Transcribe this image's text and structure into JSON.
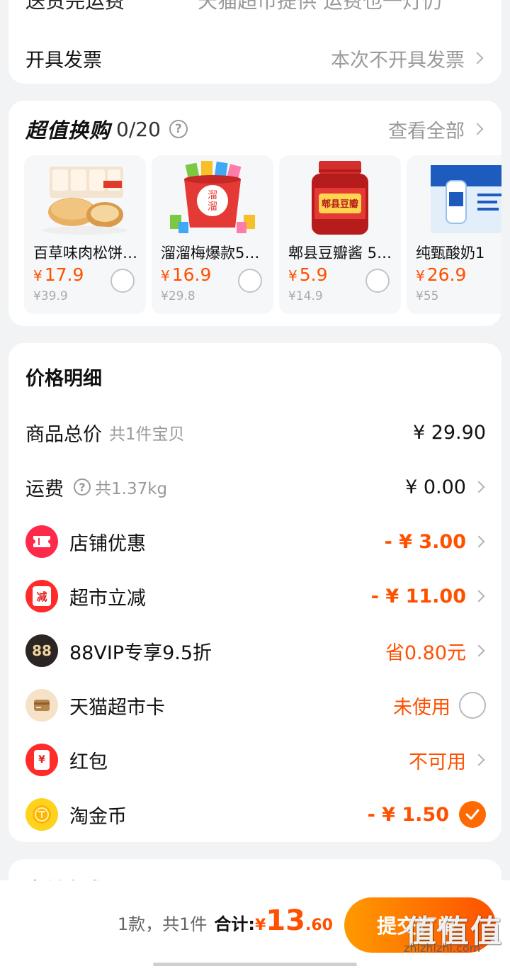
{
  "delivery": {
    "label": "送货完运费",
    "value": "天猫超市提供 运费也一灯仍"
  },
  "invoice": {
    "label": "开具发票",
    "value": "本次不开具发票"
  },
  "swap": {
    "title": "超值换购",
    "count": "0/20",
    "view_all": "查看全部",
    "products": [
      {
        "name": "百草味肉松饼…",
        "currency": "¥",
        "price": "17.9",
        "orig": "¥39.9"
      },
      {
        "name": "溜溜梅爆款5…",
        "currency": "¥",
        "price": "16.9",
        "orig": "¥29.8"
      },
      {
        "name": "郫县豆瓣酱 5…",
        "currency": "¥",
        "price": "5.9",
        "orig": "¥14.9"
      },
      {
        "name": "纯甄酸奶1",
        "currency": "¥",
        "price": "26.9",
        "orig": "¥55"
      }
    ]
  },
  "price_detail": {
    "title": "价格明细",
    "goods_total": {
      "label": "商品总价",
      "sub": "共1件宝贝",
      "value": "¥ 29.90"
    },
    "shipping": {
      "label": "运费",
      "sub": "共1.37kg",
      "value": "¥ 0.00"
    },
    "shop_discount": {
      "label": "店铺优惠",
      "value": "- ¥ 3.00"
    },
    "market_discount": {
      "label": "超市立减",
      "value": "- ¥ 11.00",
      "icon_text": "减"
    },
    "vip": {
      "label": "88VIP专享9.5折",
      "value": "省0.80元",
      "icon_text": "88"
    },
    "market_card": {
      "label": "天猫超市卡",
      "value": "未使用"
    },
    "red_packet": {
      "label": "红包",
      "value": "不可用",
      "icon_text": "¥"
    },
    "coins": {
      "label": "淘金币",
      "value": "- ¥ 1.50"
    }
  },
  "next_section": {
    "title": "支付方式"
  },
  "bottom": {
    "qty": "1款，共1件",
    "total_label": "合计:",
    "currency": "¥",
    "total_int": "13",
    "total_dec": ".60",
    "submit": "提交订单"
  },
  "watermark": {
    "main": "值值值",
    "sub": "zhizhizhi.com"
  },
  "colors": {
    "accent": "#ff5000",
    "page_bg": "#f2f3f5"
  }
}
